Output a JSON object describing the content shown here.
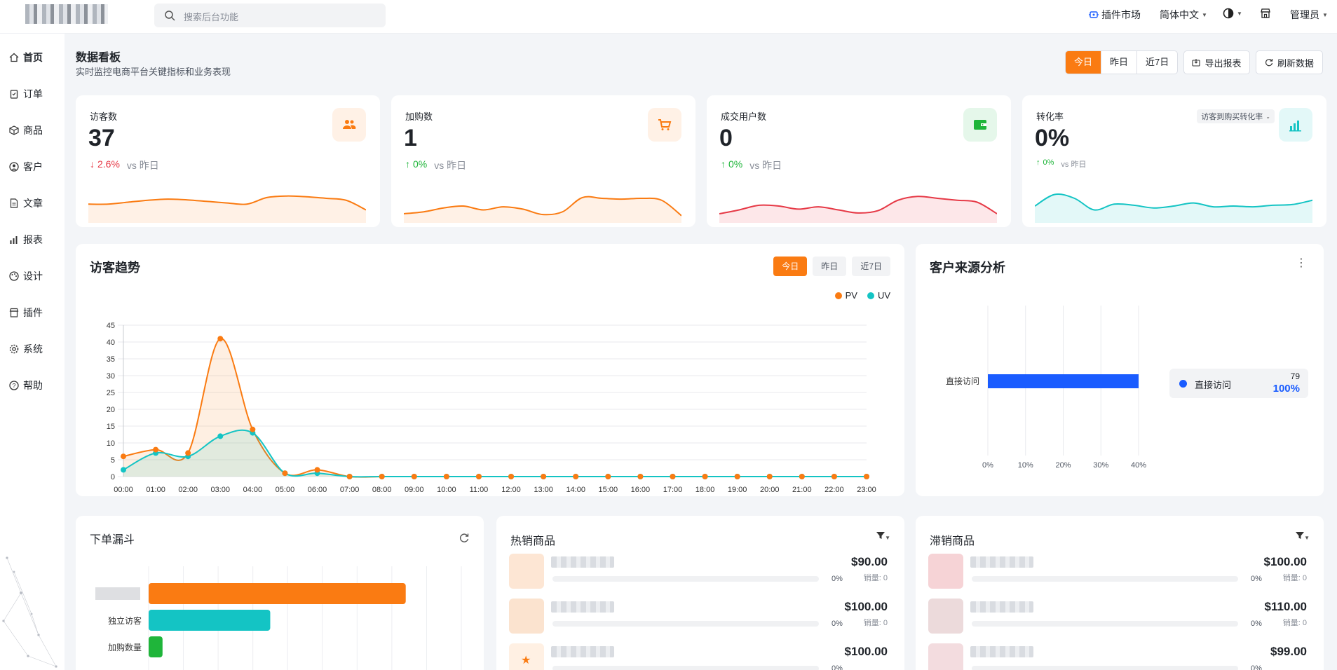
{
  "header": {
    "search_placeholder": "搜索后台功能",
    "plugin_market": "插件市场",
    "language": "简体中文",
    "user": "管理员"
  },
  "sidebar": {
    "items": [
      {
        "label": "首页",
        "icon": "home-icon"
      },
      {
        "label": "订单",
        "icon": "clipboard-icon"
      },
      {
        "label": "商品",
        "icon": "box-icon"
      },
      {
        "label": "客户",
        "icon": "user-circle-icon"
      },
      {
        "label": "文章",
        "icon": "document-icon"
      },
      {
        "label": "报表",
        "icon": "bar-chart-icon"
      },
      {
        "label": "设计",
        "icon": "palette-icon"
      },
      {
        "label": "插件",
        "icon": "store-icon"
      },
      {
        "label": "系统",
        "icon": "gear-icon"
      },
      {
        "label": "帮助",
        "icon": "help-circle-icon"
      }
    ]
  },
  "page": {
    "title": "数据看板",
    "subtitle": "实时监控电商平台关键指标和业务表现",
    "range_today": "今日",
    "range_yesterday": "昨日",
    "range_7days": "近7日",
    "export": "导出报表",
    "refresh": "刷新数据"
  },
  "kpis": [
    {
      "label": "访客数",
      "value": "37",
      "change": "2.6%",
      "direction": "down",
      "vs": "vs 昨日",
      "color": "#fa7b12",
      "icon": "users-icon"
    },
    {
      "label": "加购数",
      "value": "1",
      "change": "0%",
      "direction": "up",
      "vs": "vs 昨日",
      "color": "#fa7b12",
      "icon": "cart-icon"
    },
    {
      "label": "成交用户数",
      "value": "0",
      "change": "0%",
      "direction": "up",
      "vs": "vs 昨日",
      "color": "#e63946",
      "icon": "wallet-icon"
    },
    {
      "label": "转化率",
      "value": "0%",
      "change": "0%",
      "direction": "up",
      "vs": "vs 昨日",
      "color": "#14c4c4",
      "icon": "bar-chart-icon",
      "selector": "访客到购买转化率"
    }
  ],
  "visitor_trend": {
    "title": "访客趋势",
    "tabs": [
      "今日",
      "昨日",
      "近7日"
    ],
    "active_tab": "今日"
  },
  "source_analysis": {
    "title": "客户来源分析",
    "legend_label": "直接访问",
    "legend_count": "79",
    "legend_pct": "100%"
  },
  "funnel": {
    "title": "下单漏斗",
    "stages": [
      {
        "label": "",
        "color": "#fa7b12"
      },
      {
        "label": "独立访客",
        "color": "#14c4c4"
      },
      {
        "label": "加购数量",
        "color": "#1fb53a"
      }
    ]
  },
  "hot_products": {
    "title": "热销商品",
    "items": [
      {
        "price": "$90.00",
        "sales": "销量: 0",
        "pct": "0%"
      },
      {
        "price": "$100.00",
        "sales": "销量: 0",
        "pct": "0%"
      },
      {
        "price": "$100.00",
        "sales": "",
        "pct": "0%"
      }
    ]
  },
  "slow_products": {
    "title": "滞销商品",
    "items": [
      {
        "price": "$100.00",
        "sales": "销量: 0",
        "pct": "0%"
      },
      {
        "price": "$110.00",
        "sales": "销量: 0",
        "pct": "0%"
      },
      {
        "price": "$99.00",
        "sales": "",
        "pct": "0%"
      }
    ]
  },
  "chart_data": [
    {
      "type": "line",
      "x": [
        "00:00",
        "01:00",
        "02:00",
        "03:00",
        "04:00",
        "05:00",
        "06:00",
        "07:00",
        "08:00",
        "09:00",
        "10:00",
        "11:00",
        "12:00",
        "13:00",
        "14:00",
        "15:00",
        "16:00",
        "17:00",
        "18:00",
        "19:00",
        "20:00",
        "21:00",
        "22:00",
        "23:00"
      ],
      "series": [
        {
          "name": "PV",
          "color": "#fa7b12",
          "values": [
            6,
            8,
            7,
            41,
            14,
            1,
            2,
            0,
            0,
            0,
            0,
            0,
            0,
            0,
            0,
            0,
            0,
            0,
            0,
            0,
            0,
            0,
            0,
            0
          ]
        },
        {
          "name": "UV",
          "color": "#14c4c4",
          "values": [
            2,
            7,
            6,
            12,
            13,
            1,
            1,
            0,
            0,
            0,
            0,
            0,
            0,
            0,
            0,
            0,
            0,
            0,
            0,
            0,
            0,
            0,
            0,
            0
          ]
        }
      ],
      "yticks": [
        0,
        5,
        10,
        15,
        20,
        25,
        30,
        35,
        40,
        45
      ],
      "ylim": [
        0,
        45
      ],
      "grid": true,
      "legend_position": "top-right"
    },
    {
      "type": "bar",
      "orientation": "horizontal",
      "categories": [
        "直接访问"
      ],
      "values": [
        40
      ],
      "xticks": [
        "0%",
        "10%",
        "20%",
        "30%",
        "40%"
      ],
      "xlim": [
        0,
        40
      ],
      "color": "#1a5cff"
    },
    {
      "type": "bar",
      "orientation": "horizontal",
      "categories": [
        "",
        "独立访客",
        "加购数量"
      ],
      "values": [
        37,
        17.5,
        2
      ],
      "xlim": [
        0,
        45
      ]
    }
  ]
}
